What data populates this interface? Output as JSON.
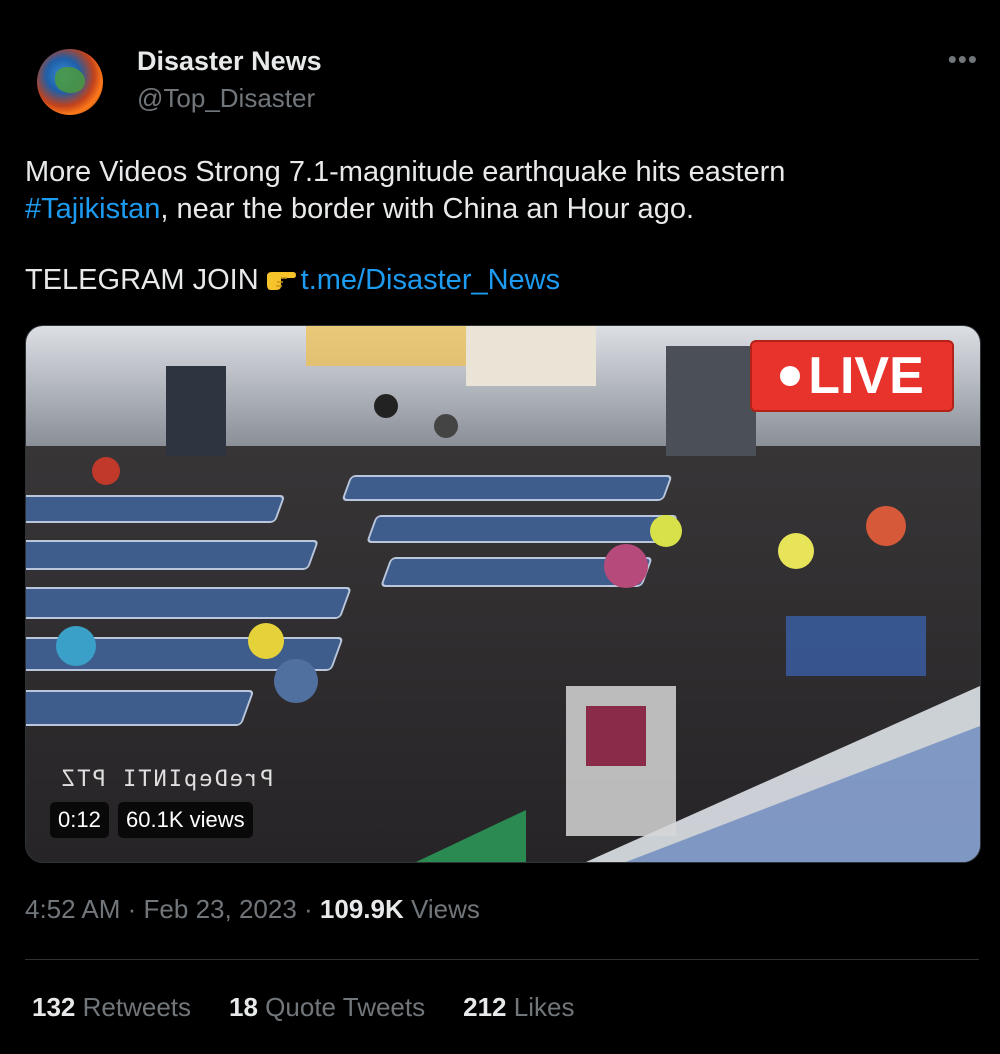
{
  "author": {
    "name": "Disaster News",
    "handle": "@Top_Disaster",
    "avatar_icon": "globe-icon"
  },
  "more_icon": "more-horizontal-icon",
  "tweet": {
    "line1": "More Videos Strong 7.1-magnitude earthquake hits eastern",
    "hashtag": "#Tajikistan",
    "line2_rest": ", near the border with China an Hour ago.",
    "telegram_label": "TELEGRAM JOIN",
    "telegram_icon": "pointing-hand-icon",
    "telegram_link": "t.me/Disaster_News"
  },
  "media": {
    "live_badge": "LIVE",
    "duration": "0:12",
    "views": "60.1K views",
    "camera_overlay": "PreDepINTI PTZ"
  },
  "meta": {
    "time": "4:52 AM",
    "separator": "·",
    "date": "Feb 23, 2023",
    "views_count": "109.9K",
    "views_label": "Views"
  },
  "stats": {
    "retweets_count": "132",
    "retweets_label": "Retweets",
    "quotes_count": "18",
    "quotes_label": "Quote Tweets",
    "likes_count": "212",
    "likes_label": "Likes"
  },
  "colors": {
    "link": "#1d9bf0",
    "live_red": "#e8332c",
    "muted": "#71767b"
  }
}
